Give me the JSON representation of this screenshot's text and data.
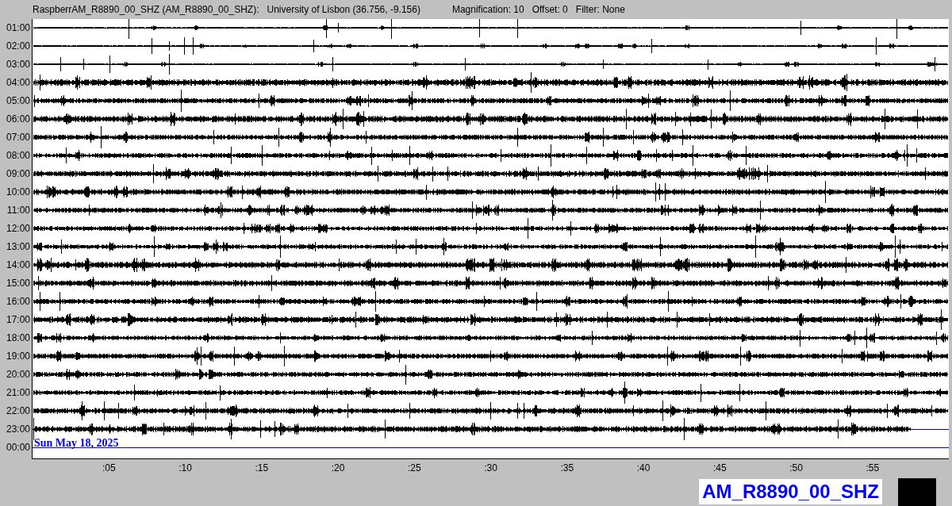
{
  "header": {
    "station": "RaspberrAM_R8890_00_SHZ (AM_R8890_00_SHZ):",
    "location": "University of Lisbon (36.756, -9.156)",
    "magnification": "Magnification: 10",
    "offset": "Offset: 0",
    "filter": "Filter: None"
  },
  "hours": [
    "01:00",
    "02:00",
    "03:00",
    "04:00",
    "05:00",
    "06:00",
    "07:00",
    "08:00",
    "09:00",
    "10:00",
    "11:00",
    "12:00",
    "13:00",
    "14:00",
    "15:00",
    "16:00",
    "17:00",
    "18:00",
    "19:00",
    "20:00",
    "21:00",
    "22:00",
    "23:00",
    "00:00"
  ],
  "date_label": "Sun May 18, 2025",
  "minute_ticks": [
    ":05",
    ":10",
    ":15",
    ":20",
    ":25",
    ":30",
    ":35",
    ":40",
    ":45",
    ":50",
    ":55"
  ],
  "station_label": "AM_R8890_00_SHZ"
}
